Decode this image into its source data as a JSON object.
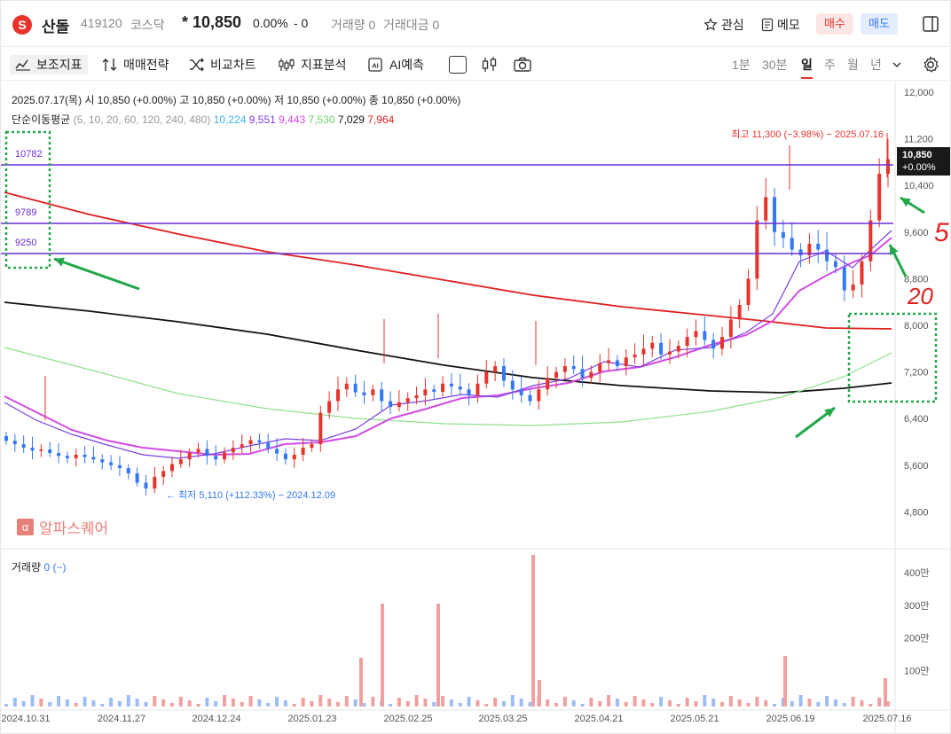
{
  "stock": {
    "logo": "S",
    "name": "산돌",
    "code": "419120",
    "market": "코스닥",
    "price": "* 10,850",
    "change": "0.00%",
    "diff": "- 0",
    "volume": "거래량 0",
    "amount": "거래대금 0"
  },
  "actions": {
    "watch": "관심",
    "memo": "메모",
    "buy": "매수",
    "sell": "매도"
  },
  "toolbar": {
    "indicator": "보조지표",
    "strategy": "매매전략",
    "compare": "비교차트",
    "analysis": "지표분석",
    "ai": "AI예측"
  },
  "periods": [
    "1분",
    "30분",
    "일",
    "주",
    "월",
    "년"
  ],
  "selected_period": "일",
  "ohlc": {
    "date": "2025.07.17(목)",
    "open": "시 10,850 (+0.00%)",
    "high": "고 10,850 (+0.00%)",
    "low": "저 10,850 (+0.00%)",
    "close": "종 10,850 (+0.00%)"
  },
  "ma": {
    "label": "단순이동평균",
    "params": "(5, 10, 20, 60, 120, 240, 480)",
    "values": [
      {
        "v": "10,224",
        "color": "#3fb4e8"
      },
      {
        "v": "9,551",
        "color": "#7b3fe4"
      },
      {
        "v": "9,443",
        "color": "#d34be4"
      },
      {
        "v": "7,530",
        "color": "#6cd36c"
      },
      {
        "v": "7,029",
        "color": "#111111"
      },
      {
        "v": "7,964",
        "color": "#e02020"
      }
    ]
  },
  "annotations": {
    "max": "최고 11,300 (−3.98%) − 2025.07.16",
    "min": "최저 5,110 (+112.33%) − 2024.12.09",
    "level1": "10782",
    "level2": "9789",
    "level3": "9250",
    "current_price": "10,850",
    "current_pct": "+0.00%",
    "hand1": "5",
    "hand2": "20"
  },
  "watermark": "알파스퀘어",
  "volume_panel": {
    "label": "거래량",
    "value": "0 (−)"
  },
  "price_axis": [
    "12,000",
    "11,200",
    "10,400",
    "9,600",
    "8,800",
    "8,000",
    "7,200",
    "6,400",
    "5,600",
    "4,800"
  ],
  "volume_axis": [
    "400만",
    "300만",
    "200만",
    "100만"
  ],
  "date_axis": [
    "2024.10.31",
    "2024.11.27",
    "2024.12.24",
    "2025.01.23",
    "2025.02.25",
    "2025.03.25",
    "2025.04.21",
    "2025.05.21",
    "2025.06.19",
    "2025.07.16"
  ],
  "colors": {
    "up": "#e8332d",
    "down": "#3478f6",
    "level": "#6a2fd6",
    "annot": "#22a74a"
  }
}
